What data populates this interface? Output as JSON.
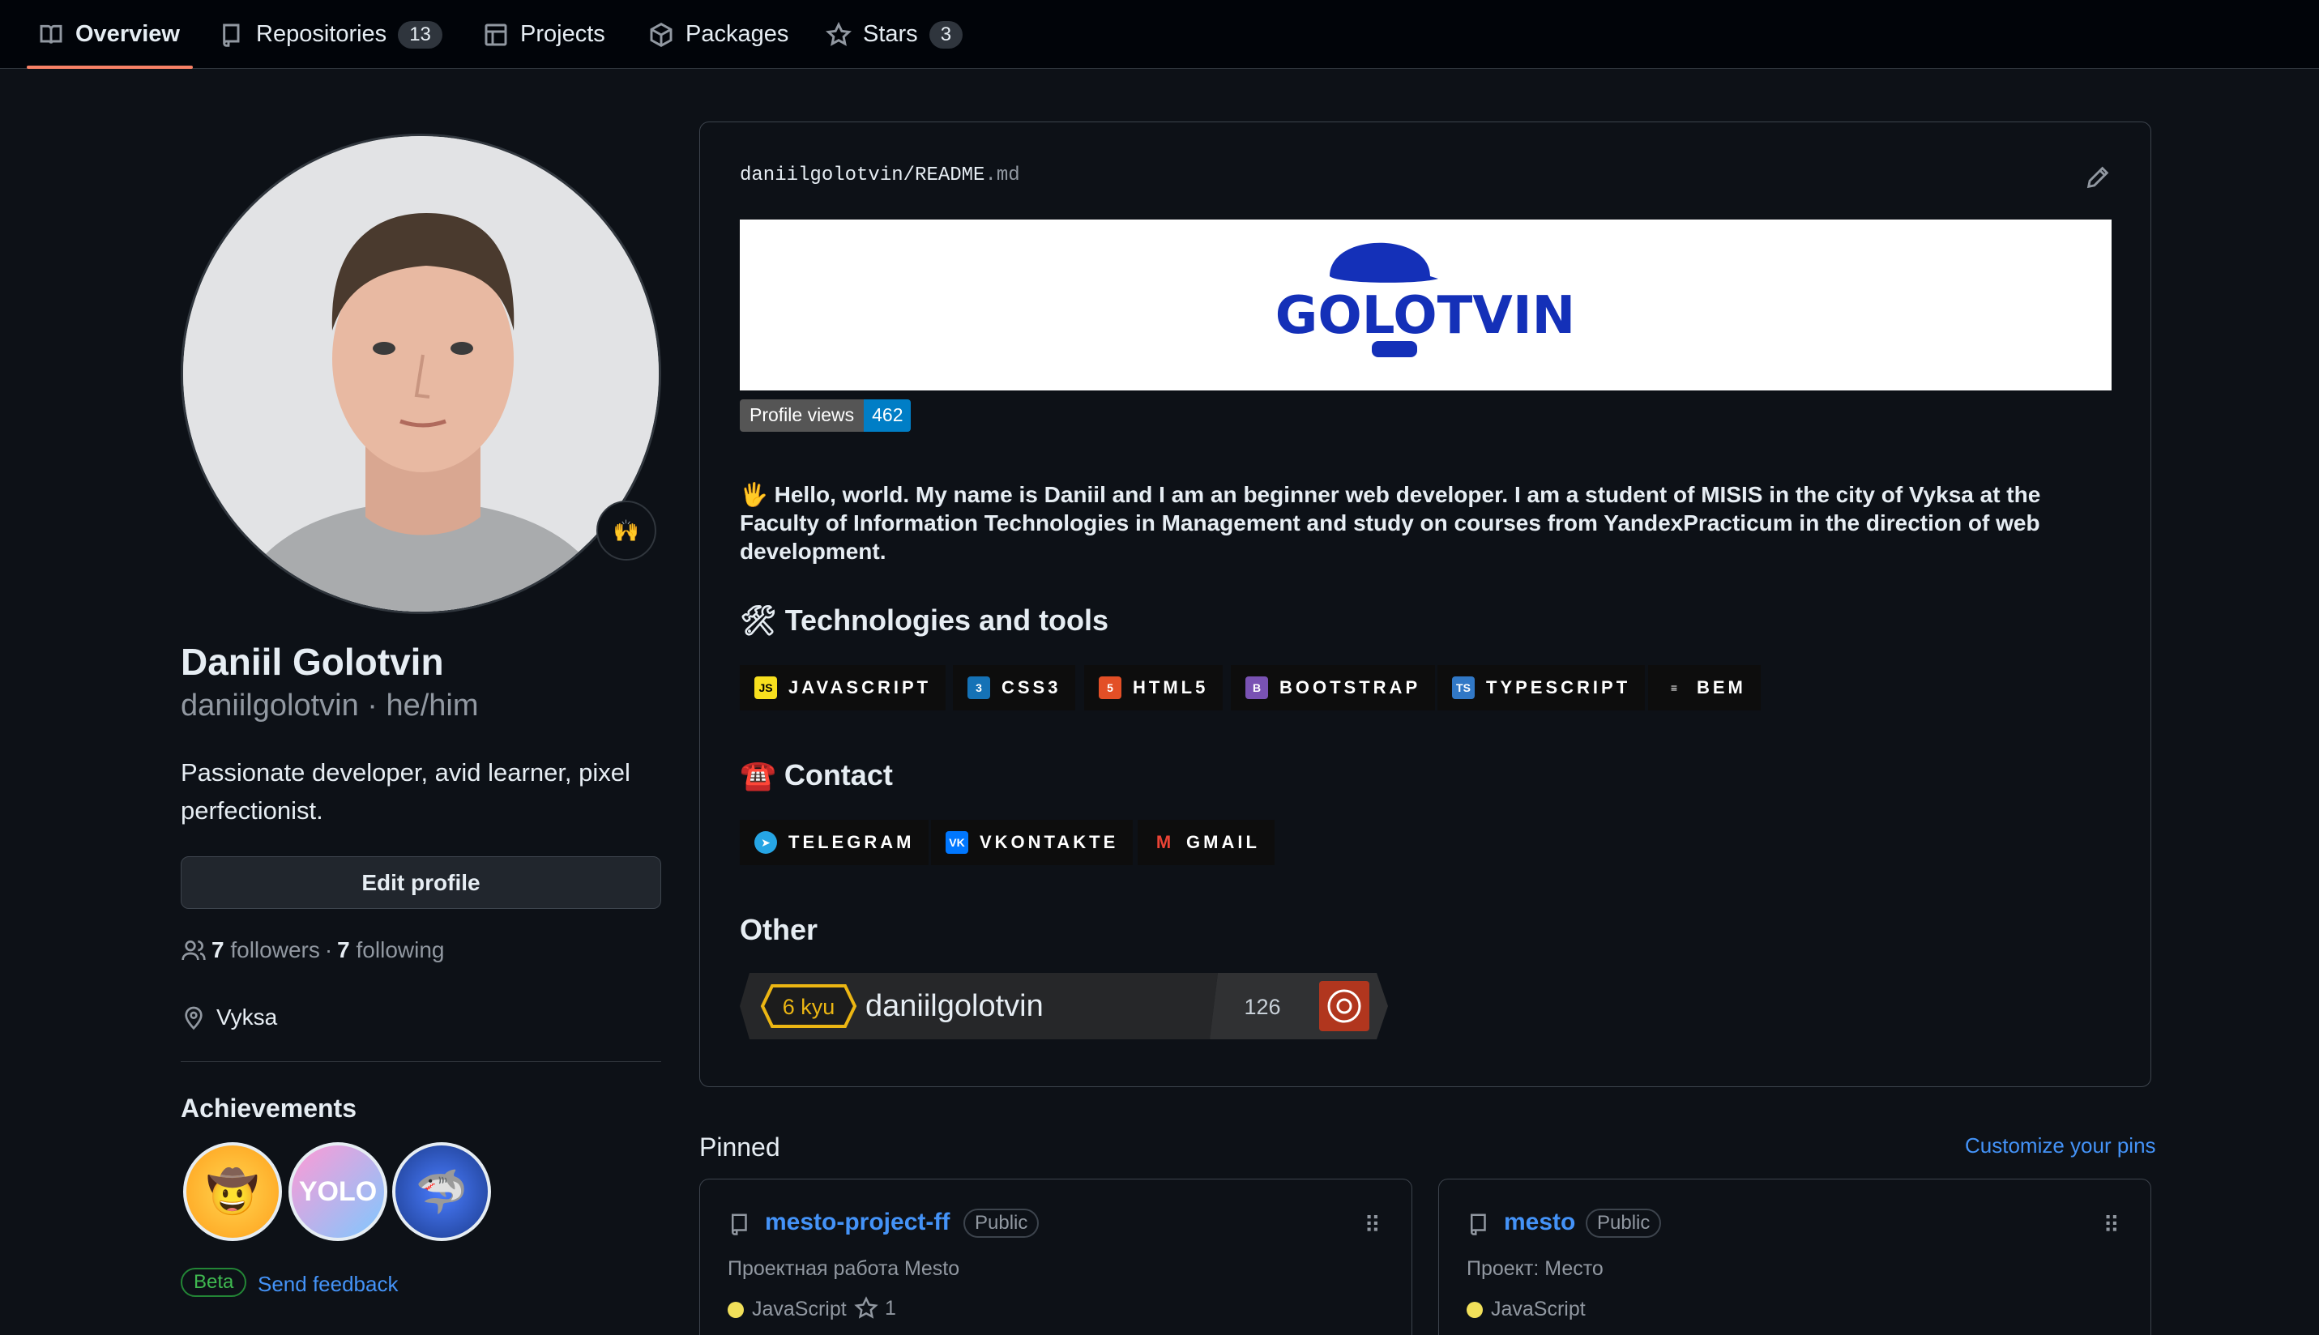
{
  "nav": {
    "tabs": [
      {
        "label": "Overview",
        "icon": "book-icon"
      },
      {
        "label": "Repositories",
        "icon": "repo-icon",
        "count": "13"
      },
      {
        "label": "Projects",
        "icon": "table-icon"
      },
      {
        "label": "Packages",
        "icon": "package-icon"
      },
      {
        "label": "Stars",
        "icon": "star-icon",
        "count": "3"
      }
    ]
  },
  "profile": {
    "status_emoji": "🙌",
    "name": "Daniil Golotvin",
    "login_line": "daniilgolotvin · he/him",
    "bio": "Passionate developer, avid learner, pixel perfectionist.",
    "edit_label": "Edit profile",
    "followers_count": "7",
    "followers_label": "followers",
    "sep": "·",
    "following_count": "7",
    "following_label": "following",
    "location": "Vyksa"
  },
  "achievements": {
    "title": "Achievements",
    "items": [
      "🤠",
      "YOLO",
      "🦈"
    ],
    "beta": "Beta",
    "feedback": "Send feedback"
  },
  "readme": {
    "owner": "daniilgolotvin",
    "slash": "/",
    "file": "README",
    "ext": ".md",
    "banner_logo": "GOLOTVIN",
    "views_label": "Profile views",
    "views_count": "462",
    "intro": "🖐 Hello, world. My name is Daniil and I am an beginner web developer. I am a student of MISIS in the city of Vyksa at the Faculty of Information Technologies in Management and study on courses from YandexPracticum in the direction of web development.",
    "tech_heading": "🛠 Technologies and tools",
    "tech": [
      {
        "label": "JAVASCRIPT",
        "icon": "JS",
        "color": "#f7df1e",
        "fg": "#000000"
      },
      {
        "label": "CSS3",
        "icon": "3",
        "color": "#1572b6",
        "fg": "#ffffff"
      },
      {
        "label": "HTML5",
        "icon": "5",
        "color": "#e34f26",
        "fg": "#ffffff"
      },
      {
        "label": "BOOTSTRAP",
        "icon": "B",
        "color": "#7952b3",
        "fg": "#ffffff"
      },
      {
        "label": "TYPESCRIPT",
        "icon": "TS",
        "color": "#3178c6",
        "fg": "#ffffff"
      },
      {
        "label": "BEM",
        "icon": "≡",
        "color": "#0d0d0d",
        "fg": "#ffffff"
      }
    ],
    "contact_heading": "☎️ Contact",
    "contacts": [
      {
        "label": "TELEGRAM",
        "icon": "➤",
        "color": "#26a5e4",
        "fg": "#ffffff"
      },
      {
        "label": "VKONTAKTE",
        "icon": "VK",
        "color": "#0077ff",
        "fg": "#ffffff"
      },
      {
        "label": "GMAIL",
        "icon": "M",
        "color": "#0d0d0d",
        "fg": "#ea4335"
      }
    ],
    "other_heading": "Other",
    "codewars": {
      "rank": "6 kyu",
      "user": "daniilgolotvin",
      "honor": "126"
    }
  },
  "pinned": {
    "title": "Pinned",
    "customize": "Customize your pins",
    "repos": [
      {
        "name": "mesto-project-ff",
        "visibility": "Public",
        "desc": "Проектная работа Mesto",
        "lang": "JavaScript",
        "stars": "1"
      },
      {
        "name": "mesto",
        "visibility": "Public",
        "desc": "Проект: Место",
        "lang": "JavaScript",
        "stars": ""
      }
    ]
  },
  "colors": {
    "accent": "#f78166",
    "link": "#4493f8",
    "js_dot": "#f1e05a"
  }
}
